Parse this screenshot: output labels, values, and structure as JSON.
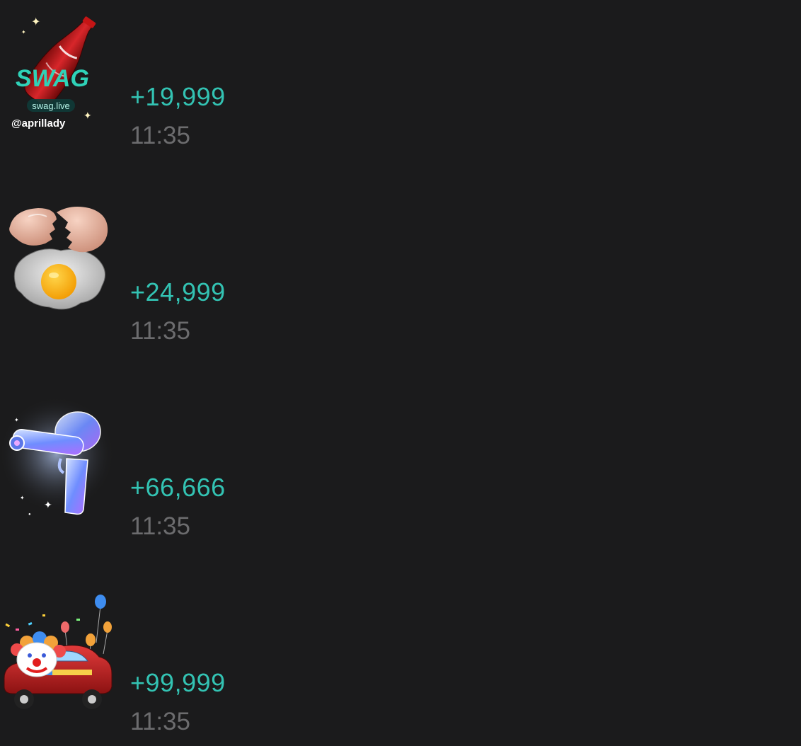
{
  "colors": {
    "background": "#1b1b1c",
    "amount": "#33c3b3",
    "time": "#6c6c6e"
  },
  "gifts": [
    {
      "icon": "soda-bottle-gift-icon",
      "badge": {
        "logo": "SWAG",
        "site": "swag.live",
        "handle": "@aprillady"
      },
      "amount": "+19,999",
      "time": "11:35"
    },
    {
      "icon": "cracked-egg-gift-icon",
      "amount": "+24,999",
      "time": "11:35"
    },
    {
      "icon": "water-gun-gift-icon",
      "amount": "+66,666",
      "time": "11:35"
    },
    {
      "icon": "clown-car-gift-icon",
      "amount": "+99,999",
      "time": "11:35"
    }
  ]
}
